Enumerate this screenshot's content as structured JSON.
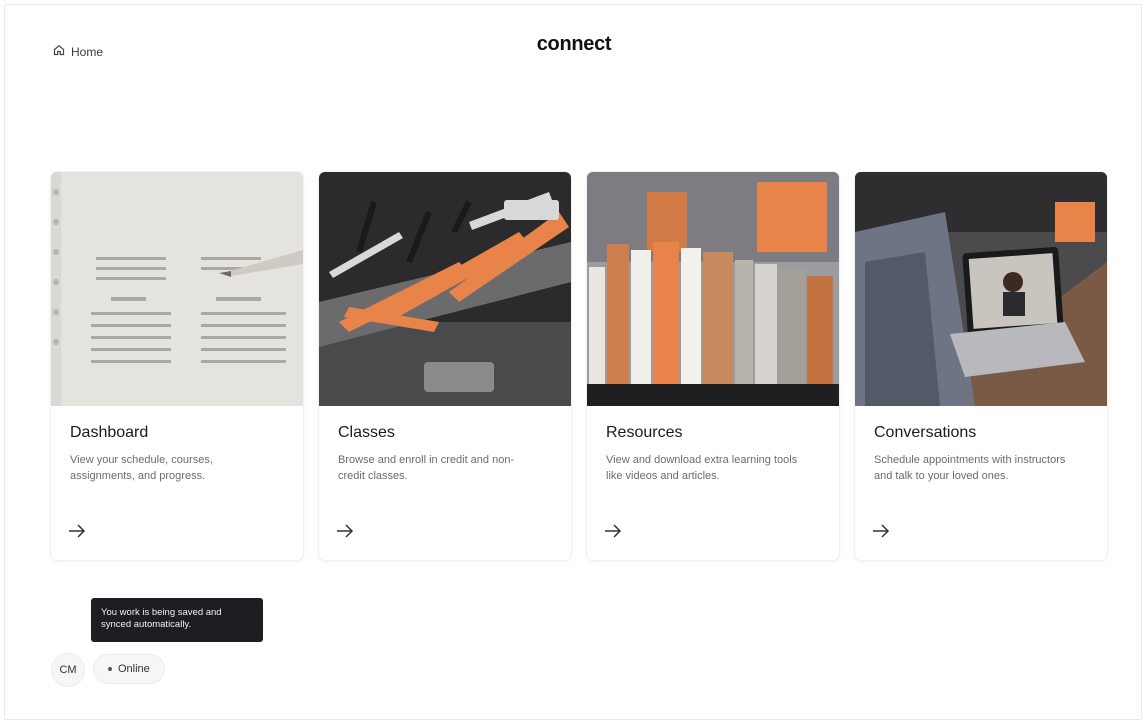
{
  "header": {
    "home_label": "Home",
    "logo_text": "connect"
  },
  "cards": [
    {
      "title": "Dashboard",
      "description": "View your schedule, courses, assignments, and progress.",
      "image": "calendar-photo"
    },
    {
      "title": "Classes",
      "description": "Browse and enroll in credit and non-credit classes.",
      "image": "pencil-tray-photo"
    },
    {
      "title": "Resources",
      "description": "View and download extra learning tools like videos and articles.",
      "image": "books-photo"
    },
    {
      "title": "Conversations",
      "description": "Schedule appointments with instructors and talk to your loved ones.",
      "image": "video-call-photo"
    }
  ],
  "tooltip": {
    "text": "You work is being saved and synced automatically."
  },
  "footer": {
    "avatar_initials": "CM",
    "status_label": "Online"
  },
  "colors": {
    "accent": "#e8834a",
    "tooltip_bg": "#1d1d22",
    "text_primary": "#1b1b1f",
    "text_muted": "#6b6b73"
  },
  "icons": {
    "home": "house-icon",
    "card_arrow": "arrow-right-icon",
    "status": "status-dot-icon"
  }
}
